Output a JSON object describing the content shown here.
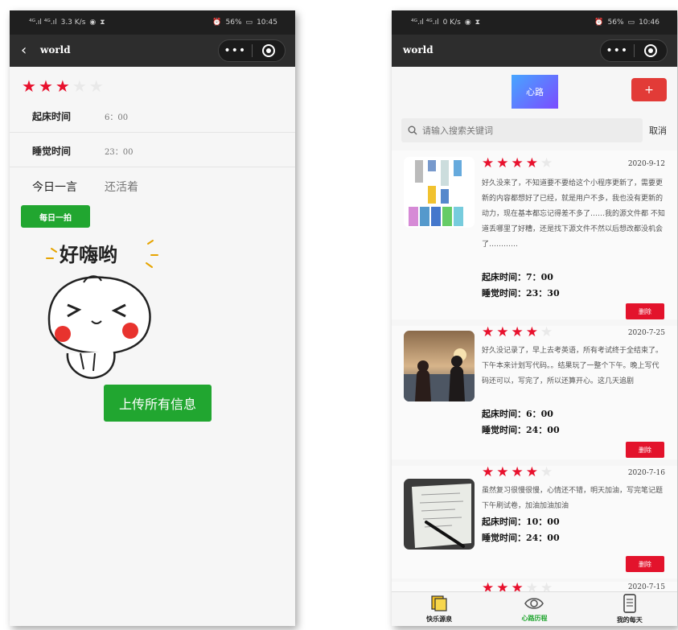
{
  "left_page": {
    "status": {
      "signal": "⁴ᴳ.ıl ⁴ᴳ.ıl",
      "speed": "3.3 K/s",
      "battery": "56%",
      "time": "10:45"
    },
    "nav": {
      "back_icon": "chevron-left-icon",
      "title": "world",
      "more": "•••",
      "close_icon": "close-circle-icon"
    },
    "rating": {
      "score": 3,
      "max": 5
    },
    "rows": [
      {
        "label": "起床时间",
        "value": "6：00"
      },
      {
        "label": "睡觉时间",
        "value": "23：00"
      }
    ],
    "motto": {
      "label": "今日一言",
      "value": "还活着"
    },
    "daily_button": "每日一拍",
    "sticker": {
      "icon": "cartoon-bun-sticker",
      "caption": "好嗨哟"
    },
    "upload_button": "上传所有信息",
    "colors": {
      "accent_green": "#21a630",
      "star_red": "#e8112d"
    }
  },
  "right_page": {
    "status": {
      "signal": "⁴ᴳ.ıl ⁴ᴳ.ıl",
      "speed": "0 K/s",
      "battery": "56%",
      "time": "10:46"
    },
    "nav": {
      "title": "world",
      "more": "•••",
      "close_icon": "close-circle-icon"
    },
    "logo": "心路",
    "add_button": "+",
    "search": {
      "placeholder": "请输入搜索关键词",
      "cancel": "取消"
    },
    "entries": [
      {
        "rating": 4,
        "date": "2020-9-12",
        "image": "app-screenshot-thumbnail",
        "text": "好久没来了，不知道要不要给这个小程序更新了，需要更新的内容都想好了已经，就是用户不多，我也没有更新的动力，现在基本都忘记得差不多了……我的源文件都 不知道丢哪里了好糟，还是找下源文件不然以后想改都没机会了…………",
        "wake": "起床时间：7：00",
        "sleep": "睡觉时间：23：30",
        "delete": "删除"
      },
      {
        "rating": 4,
        "date": "2020-7-25",
        "image": "couple-sunset-photo",
        "text": "好久没记录了，早上去考英语，所有考试终于全结束了。下午本来计划写代码。。结果玩了一整个下午。晚上写代码还可以，写完了，所以还算开心。这几天追剧",
        "wake": "起床时间：6：00",
        "sleep": "睡觉时间：24：00",
        "delete": "删除"
      },
      {
        "rating": 4,
        "date": "2020-7-16",
        "image": "notebook-pen-photo",
        "text": "虽然复习很慢很慢，心情还不错，明天加油，写完笔记题下午刷试卷，加油加油加油",
        "wake": "起床时间：10：00",
        "sleep": "睡觉时间：24：00",
        "delete": "删除"
      },
      {
        "rating": 3,
        "date": "2020-7-15"
      }
    ],
    "tabs": [
      {
        "label": "快乐源泉",
        "icon": "sticky-note-icon",
        "active": false
      },
      {
        "label": "心路历程",
        "icon": "eye-icon",
        "active": true
      },
      {
        "label": "我的每天",
        "icon": "phone-calendar-icon",
        "active": false
      }
    ]
  }
}
